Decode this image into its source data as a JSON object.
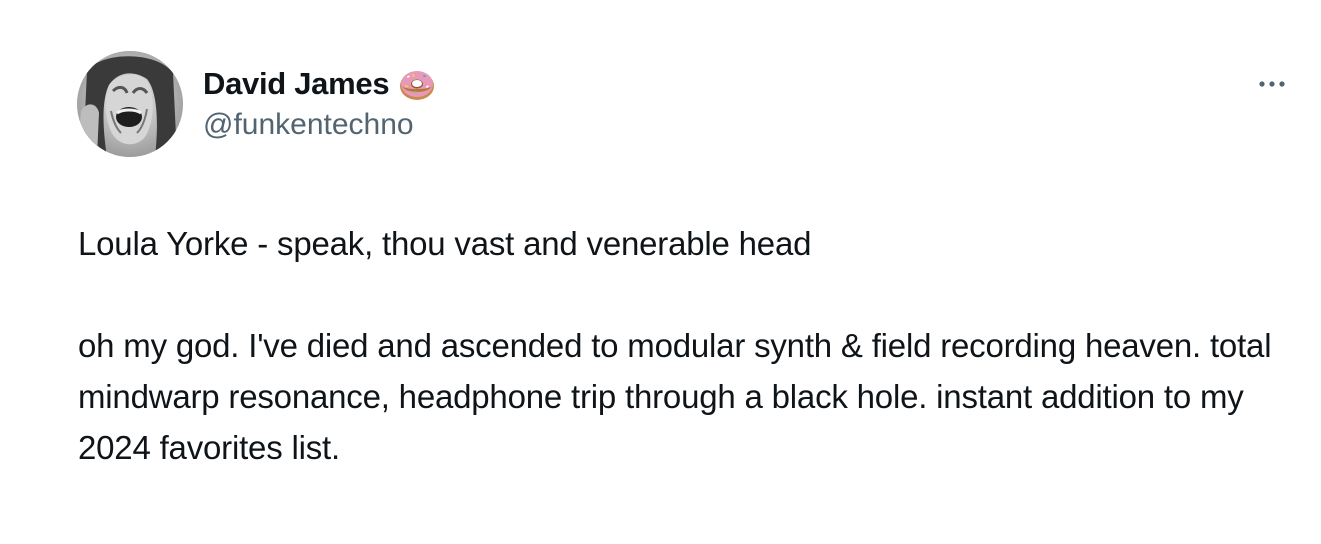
{
  "author": {
    "display_name": "David James",
    "handle": "@funkentechno",
    "name_emoji": "donut-icon",
    "avatar": "avatar-image"
  },
  "menu": {
    "icon": "more-horizontal-icon"
  },
  "tweet": {
    "paragraphs": [
      "Loula Yorke - speak, thou vast and venerable head",
      "oh my god. I've died and ascended to modular synth & field recording heaven. total mindwarp resonance, headphone trip through a black hole. instant addition to my 2024 favorites list."
    ]
  }
}
